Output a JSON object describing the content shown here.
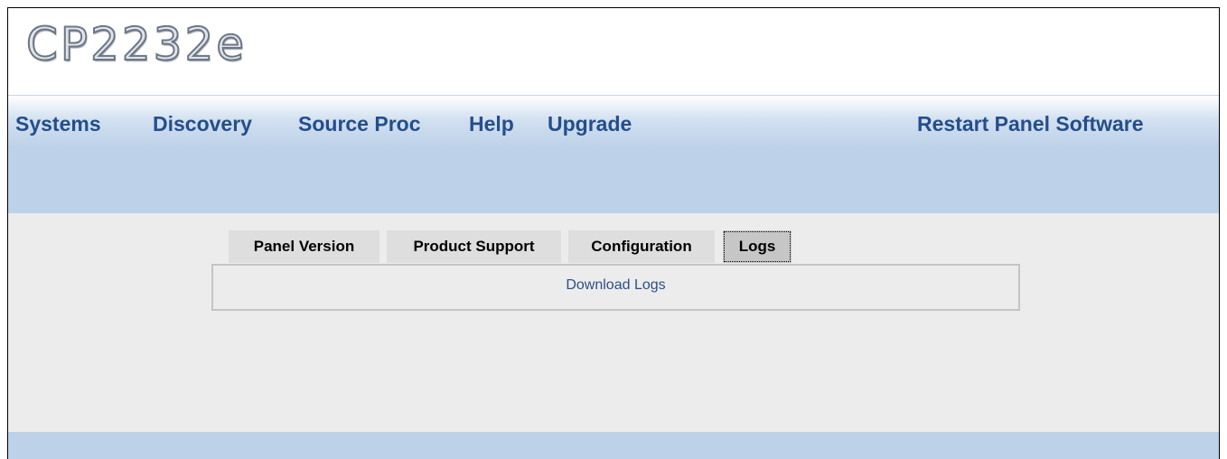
{
  "header": {
    "logo_text": "CP2232e"
  },
  "nav": {
    "items": [
      {
        "label": "Systems"
      },
      {
        "label": "Discovery"
      },
      {
        "label": "Source Proc"
      },
      {
        "label": "Help"
      },
      {
        "label": "Upgrade"
      }
    ],
    "restart_label": "Restart Panel Software"
  },
  "tabs": [
    {
      "label": "Panel Version",
      "active": false
    },
    {
      "label": "Product Support",
      "active": false
    },
    {
      "label": "Configuration",
      "active": false
    },
    {
      "label": "Logs",
      "active": true
    }
  ],
  "panel": {
    "link_label": "Download Logs"
  },
  "colors": {
    "nav_text": "#244e8c",
    "nav_bg": "#bdd1e8",
    "page_bg": "#ececec",
    "link": "#2d4f87"
  }
}
